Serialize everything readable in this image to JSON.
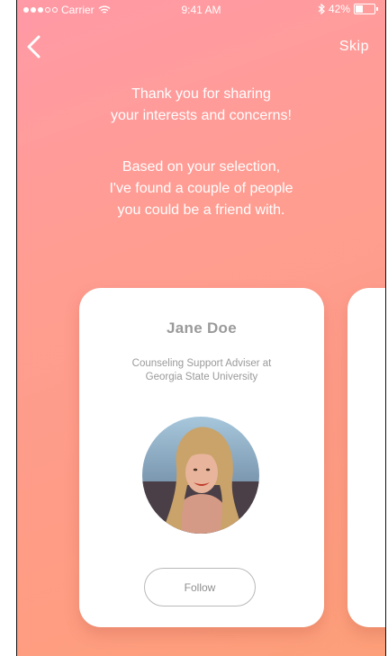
{
  "status_bar": {
    "carrier": "Carrier",
    "time": "9:41 AM",
    "battery": "42%",
    "battery_level": 0.42,
    "signal_bars_filled": 3,
    "signal_bars_total": 5,
    "icons": [
      "wifi-icon",
      "bluetooth-icon",
      "battery-icon"
    ]
  },
  "nav": {
    "back_icon": "chevron-left-icon",
    "skip_label": "Skip"
  },
  "intro": {
    "paragraph1": [
      "Thank you for sharing",
      "your interests and concerns!"
    ],
    "paragraph2": [
      "Based on your selection,",
      "I've found a couple of people",
      "you could be a friend with."
    ]
  },
  "card": {
    "name": "Jane Doe",
    "title_lines": [
      "Counseling Support Adviser at",
      "Georgia State University"
    ],
    "follow_label": "Follow"
  },
  "colors": {
    "gradient_top": "#ff9aa6",
    "gradient_bottom": "#fd9f79",
    "card_text": "#9a9a9a"
  }
}
